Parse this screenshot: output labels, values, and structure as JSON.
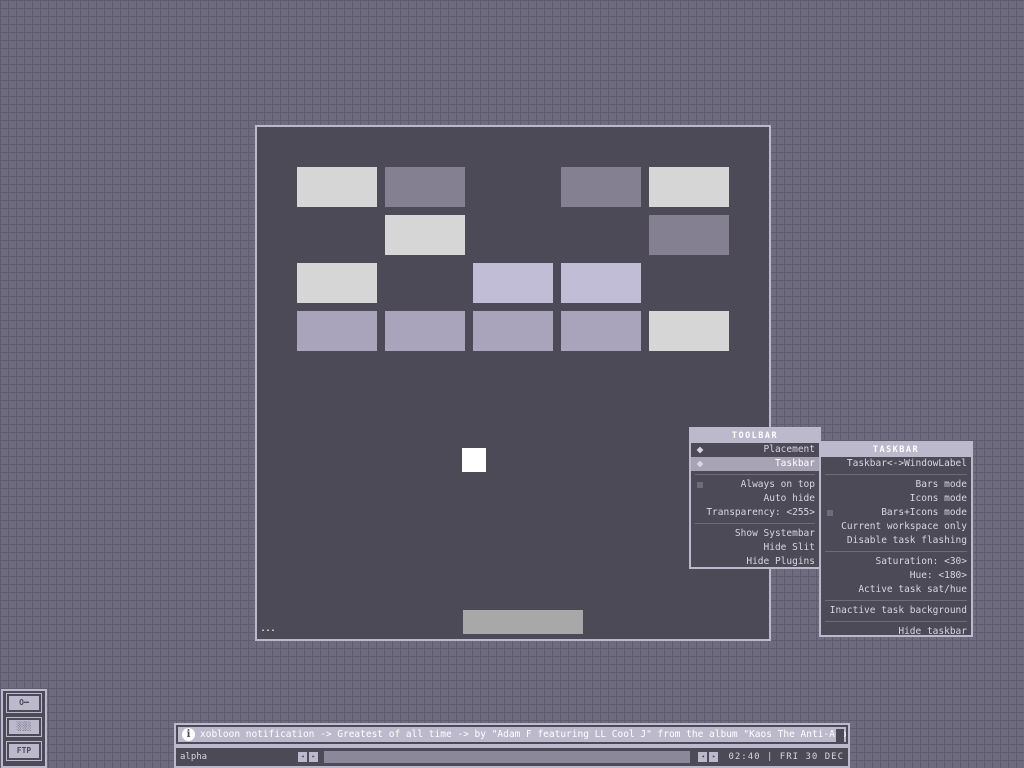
{
  "colors": {
    "desktop": "#6e6b7e",
    "window_bg": "#4d4a57",
    "border": "#bdb9cd",
    "brick_light": "#d6d6d6",
    "brick_dark": "#858091",
    "brick_lavender": "#c2bdd7",
    "brick_mauve": "#a9a4bc",
    "paddle": "#a9a8a8",
    "ball": "#ffffff"
  },
  "game": {
    "ellipsis": "...",
    "bricks": [
      {
        "col": 0,
        "row": 0,
        "color": "#d6d6d6"
      },
      {
        "col": 1,
        "row": 0,
        "color": "#858091"
      },
      {
        "col": 3,
        "row": 0,
        "color": "#858091"
      },
      {
        "col": 4,
        "row": 0,
        "color": "#d6d6d6"
      },
      {
        "col": 1,
        "row": 1,
        "color": "#d6d6d6"
      },
      {
        "col": 4,
        "row": 1,
        "color": "#858091"
      },
      {
        "col": 0,
        "row": 2,
        "color": "#d6d6d6"
      },
      {
        "col": 2,
        "row": 2,
        "color": "#c2bdd7"
      },
      {
        "col": 3,
        "row": 2,
        "color": "#c2bdd7"
      },
      {
        "col": 0,
        "row": 3,
        "color": "#a9a4bc"
      },
      {
        "col": 1,
        "row": 3,
        "color": "#a9a4bc"
      },
      {
        "col": 2,
        "row": 3,
        "color": "#a9a4bc"
      },
      {
        "col": 3,
        "row": 3,
        "color": "#a9a4bc"
      },
      {
        "col": 4,
        "row": 3,
        "color": "#d6d6d6"
      }
    ]
  },
  "toolbar_menu": {
    "title": "TOOLBAR",
    "placement": "Placement",
    "taskbar": "Taskbar",
    "always_on_top": "Always on top",
    "auto_hide": "Auto hide",
    "transparency": "Transparency: <255>",
    "show_systembar": "Show Systembar",
    "hide_slit": "Hide Slit",
    "hide_plugins": "Hide Plugins"
  },
  "taskbar_menu": {
    "title": "TASKBAR",
    "taskbar_windowlabel": "Taskbar<->WindowLabel",
    "bars_mode": "Bars mode",
    "icons_mode": "Icons mode",
    "bars_icons_mode": "Bars+Icons mode",
    "current_workspace_only": "Current workspace only",
    "disable_task_flashing": "Disable task flashing",
    "saturation": "Saturation: <30>",
    "hue": "Hue: <180>",
    "active_task_sat_hue": "Active task sat/hue",
    "inactive_task_background": "Inactive task background",
    "hide_taskbar": "Hide taskbar"
  },
  "slit": {
    "key_icon": "O━",
    "keyboard_icon": "░░░",
    "ftp_label": "FTP"
  },
  "notification": {
    "icon": "i",
    "text": "xobloon notification -> Greatest of all time -> by \"Adam F featuring LL Cool J\" from the album \"Kaos The Anti-Acoustic War..."
  },
  "taskbar": {
    "workspace": "alpha",
    "arrow_left": "◂",
    "arrow_right": "▸",
    "clock": "02:40 | FRI 30 DEC"
  }
}
